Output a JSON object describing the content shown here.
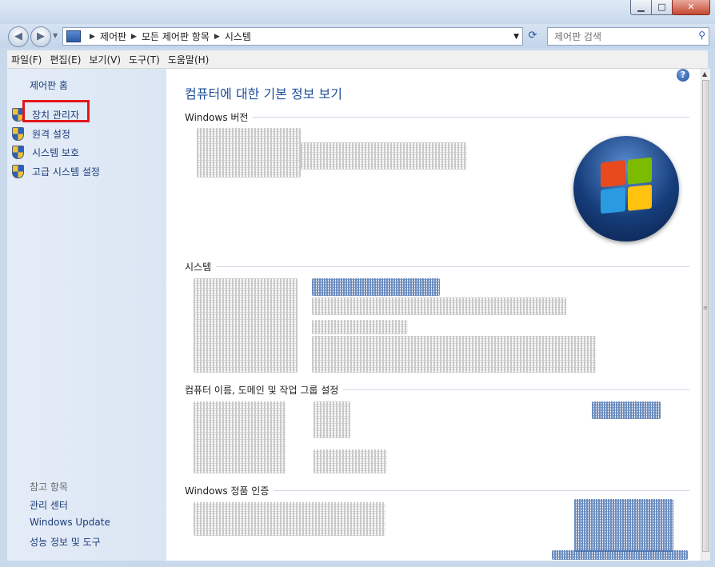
{
  "window": {
    "min_label": "▁",
    "max_label": "□",
    "close_label": "✕"
  },
  "nav": {
    "back_glyph": "◀",
    "forward_glyph": "▶",
    "breadcrumb": [
      "제어판",
      "모든 제어판 항목",
      "시스템"
    ],
    "separator": "▶",
    "search_placeholder": "제어판 검색",
    "refresh_glyph": "⟳"
  },
  "menu": {
    "items": [
      "파일(F)",
      "편집(E)",
      "보기(V)",
      "도구(T)",
      "도움말(H)"
    ]
  },
  "sidebar": {
    "home_link": "제어판 홈",
    "tasks": [
      {
        "label": "장치 관리자",
        "icon": "uac-shield-icon"
      },
      {
        "label": "원격 설정",
        "icon": "uac-shield-icon"
      },
      {
        "label": "시스템 보호",
        "icon": "uac-shield-icon"
      },
      {
        "label": "고급 시스템 설정",
        "icon": "uac-shield-icon"
      }
    ],
    "see_also_title": "참고 항목",
    "see_also": [
      "관리 센터",
      "Windows Update",
      "성능 정보 및 도구"
    ]
  },
  "main": {
    "help_glyph": "?",
    "title": "컴퓨터에 대한 기본 정보 보기",
    "sections": {
      "windows_edition": "Windows 버전",
      "system": "시스템",
      "computer_name": "컴퓨터 이름, 도메인 및 작업 그룹 설정",
      "activation": "Windows 정품 인증"
    }
  },
  "colors": {
    "highlight_box": "#e3161c",
    "title_blue": "#1e4e99",
    "link_blue": "#1c3d7a"
  }
}
